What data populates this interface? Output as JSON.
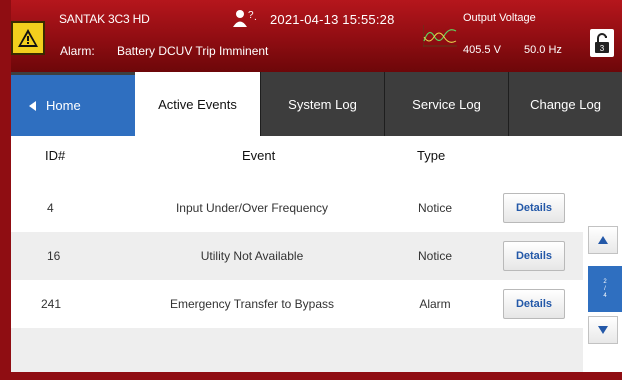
{
  "header": {
    "device_name": "SANTAK 3C3 HD",
    "alarm_label": "Alarm:",
    "alarm_text": "Battery DCUV Trip Imminent",
    "datetime": "2021-04-13  15:55:28",
    "output_label": "Output Voltage",
    "output_voltage": "405.5 V",
    "output_frequency": "50.0 Hz",
    "help_icon": "user-question-icon",
    "lock_icon": "unlock-icon",
    "lock_level": "3",
    "warning_icon": "warning-icon",
    "colors": {
      "header_bg": "#8f0d12",
      "warning": "#f2cf1d"
    }
  },
  "tabs": {
    "home": "Home",
    "active_events": "Active Events",
    "system_log": "System Log",
    "service_log": "Service Log",
    "change_log": "Change Log",
    "colors": {
      "home_bg": "#2f6fc0",
      "tab_bg": "#3d3d3d"
    }
  },
  "table": {
    "headers": {
      "id": "ID#",
      "event": "Event",
      "type": "Type"
    },
    "rows": [
      {
        "id": "4",
        "event": "Input Under/Over Frequency",
        "type": "Notice",
        "button": "Details"
      },
      {
        "id": "16",
        "event": "Utility Not Available",
        "type": "Notice",
        "button": "Details"
      },
      {
        "id": "241",
        "event": "Emergency Transfer to Bypass",
        "type": "Alarm",
        "button": "Details"
      }
    ]
  },
  "pager": {
    "current": "2",
    "separator": "/",
    "total": "4",
    "up_icon": "arrow-up-icon",
    "down_icon": "arrow-down-icon"
  }
}
